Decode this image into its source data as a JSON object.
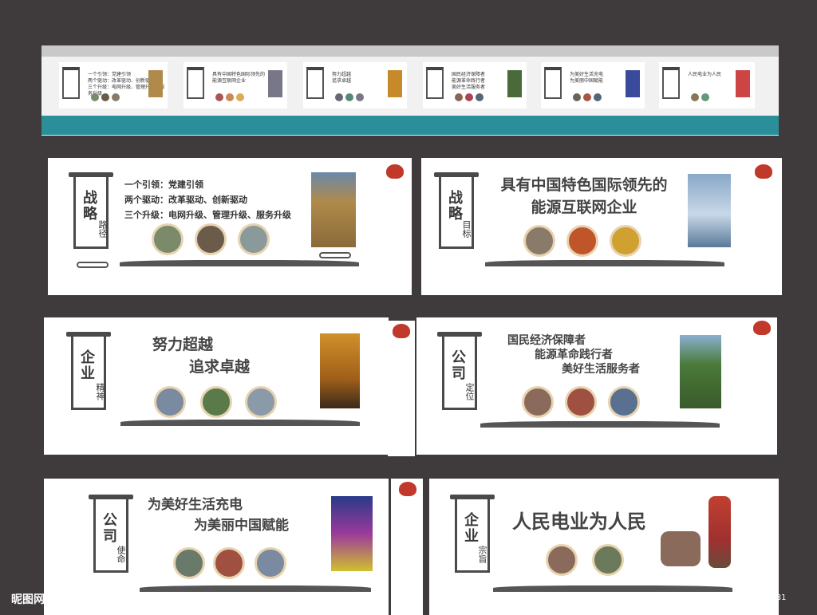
{
  "strip": {
    "mini_panels": [
      {
        "lines": [
          "一个引领：党建引领",
          "两个驱动：改革驱动、创新驱动",
          "三个升级：电网升级、管理升级、服务升级"
        ]
      },
      {
        "lines": [
          "具有中国特色国际领先的",
          "能源互联网企业"
        ]
      },
      {
        "lines": [
          "努力超越",
          "追求卓越"
        ]
      },
      {
        "lines": [
          "国民经济保障者",
          "能源革命践行者",
          "美好生活服务者"
        ]
      },
      {
        "lines": [
          "为美好生活充电",
          "为美丽中国赋能"
        ]
      },
      {
        "lines": [
          "人民电业为人民"
        ]
      }
    ]
  },
  "panels": {
    "p1": {
      "v_title": "战略",
      "v_sub": "路径",
      "lines": [
        "一个引领：党建引领",
        "两个驱动：改革驱动、创新驱动",
        "三个升级：电网升级、管理升级、服务升级"
      ]
    },
    "p2": {
      "v_title": "战略",
      "v_sub": "目标",
      "lines": [
        "具有中国特色国际领先的",
        "能源互联网企业"
      ]
    },
    "p3": {
      "v_title": "企业",
      "v_sub": "精神",
      "lines": [
        "努力超越",
        "追求卓越"
      ]
    },
    "p4": {
      "v_title": "公司",
      "v_sub": "定位",
      "lines": [
        "国民经济保障者",
        "能源革命践行者",
        "美好生活服务者"
      ]
    },
    "p5": {
      "v_title": "公司",
      "v_sub": "使命",
      "lines": [
        "为美好生活充电",
        "为美丽中国赋能"
      ]
    },
    "p6": {
      "v_title": "企业",
      "v_sub": "宗旨",
      "lines": [
        "人民电业为人民"
      ]
    }
  },
  "watermark": "昵图网 www.nipic.com",
  "id_text": "ID:6380949 NO:20201129172244458081",
  "colors": {
    "background": "#3f3a3b",
    "band": "#2b8f9a",
    "ink": "#444444",
    "accent": "#c0392b",
    "frame": "#e7d3b0"
  }
}
